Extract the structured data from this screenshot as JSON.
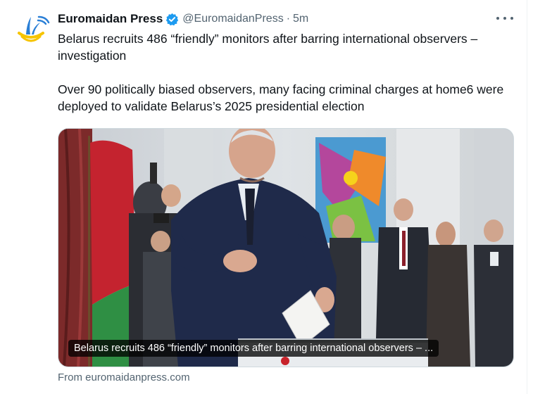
{
  "author": {
    "name": "Euromaidan Press",
    "handle": "@EuromaidanPress",
    "separator": "·",
    "time": "5m",
    "avatar_icon": "euromaidan-press-logo",
    "verified_icon": "verified-badge-icon",
    "verified_color": "#1d9bf0"
  },
  "more_icon": "more-options-icon",
  "tweet": {
    "text": "Belarus recruits 486 “friendly” monitors after barring international observers – investigation\n\nOver 90 politically biased observers, many facing criminal charges at home6 were deployed to validate Belarus’s 2025 presidential election"
  },
  "link_card": {
    "title": "Belarus recruits 486 “friendly” monitors after barring international observers – ...",
    "source": "From euromaidanpress.com"
  }
}
